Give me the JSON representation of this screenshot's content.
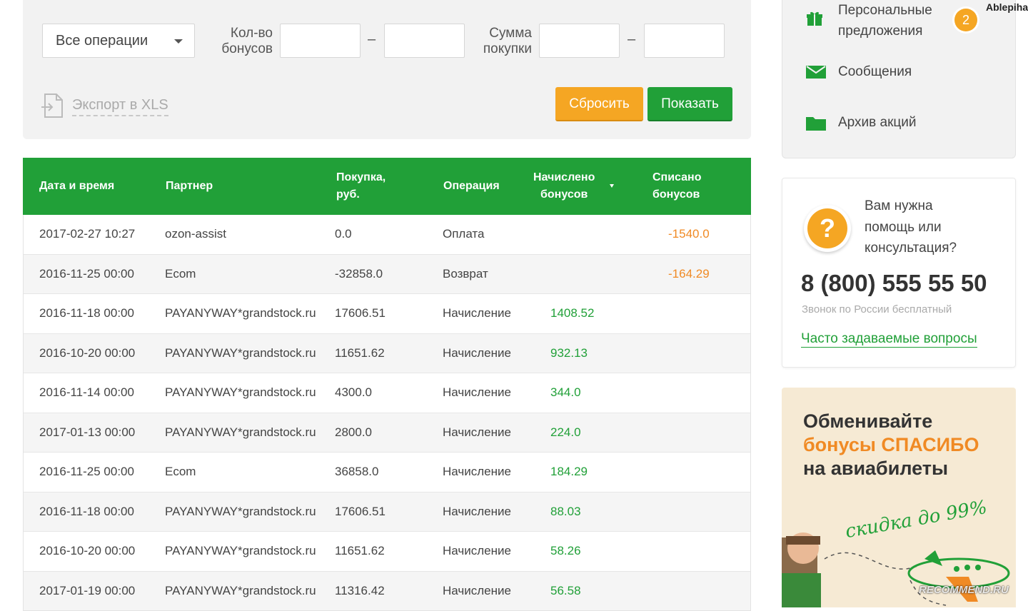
{
  "filters": {
    "operation_select": "Все операции",
    "bonus_count_label_1": "Кол-во",
    "bonus_count_label_2": "бонусов",
    "purchase_sum_label_1": "Сумма",
    "purchase_sum_label_2": "покупки",
    "range_dash": "–",
    "export_label": "Экспорт в XLS",
    "reset_label": "Сбросить",
    "show_label": "Показать"
  },
  "table": {
    "headers": {
      "date": "Дата и время",
      "partner": "Партнер",
      "amount_1": "Покупка,",
      "amount_2": "руб.",
      "operation": "Операция",
      "earned_1": "Начислено",
      "earned_2": "бонусов",
      "spent_1": "Списано",
      "spent_2": "бонусов"
    },
    "rows": [
      {
        "date": "2017-02-27 10:27",
        "partner": "ozon-assist",
        "amount": "0.0",
        "operation": "Оплата",
        "earned": "",
        "spent": "-1540.0"
      },
      {
        "date": "2016-11-25 00:00",
        "partner": "Ecom",
        "amount": "-32858.0",
        "operation": "Возврат",
        "earned": "",
        "spent": "-164.29"
      },
      {
        "date": "2016-11-18 00:00",
        "partner": "PAYANYWAY*grandstock.ru",
        "amount": "17606.51",
        "operation": "Начисление",
        "earned": "1408.52",
        "spent": ""
      },
      {
        "date": "2016-10-20 00:00",
        "partner": "PAYANYWAY*grandstock.ru",
        "amount": "11651.62",
        "operation": "Начисление",
        "earned": "932.13",
        "spent": ""
      },
      {
        "date": "2016-11-14 00:00",
        "partner": "PAYANYWAY*grandstock.ru",
        "amount": "4300.0",
        "operation": "Начисление",
        "earned": "344.0",
        "spent": ""
      },
      {
        "date": "2017-01-13 00:00",
        "partner": "PAYANYWAY*grandstock.ru",
        "amount": "2800.0",
        "operation": "Начисление",
        "earned": "224.0",
        "spent": ""
      },
      {
        "date": "2016-11-25 00:00",
        "partner": "Ecom",
        "amount": "36858.0",
        "operation": "Начисление",
        "earned": "184.29",
        "spent": ""
      },
      {
        "date": "2016-11-18 00:00",
        "partner": "PAYANYWAY*grandstock.ru",
        "amount": "17606.51",
        "operation": "Начисление",
        "earned": "88.03",
        "spent": ""
      },
      {
        "date": "2016-10-20 00:00",
        "partner": "PAYANYWAY*grandstock.ru",
        "amount": "11651.62",
        "operation": "Начисление",
        "earned": "58.26",
        "spent": ""
      },
      {
        "date": "2017-01-19 00:00",
        "partner": "PAYANYWAY*grandstock.ru",
        "amount": "11316.42",
        "operation": "Начисление",
        "earned": "56.58",
        "spent": ""
      }
    ]
  },
  "sidebar": {
    "offers_1": "Персональные",
    "offers_2": "предложения",
    "offers_badge": "2",
    "messages": "Сообщения",
    "archive": "Архив акций",
    "watermark": "Ablepiha"
  },
  "help": {
    "icon_symbol": "?",
    "text_1": "Вам нужна",
    "text_2": "помощь или",
    "text_3": "консультация?",
    "phone": "8 (800) 555 55 50",
    "phone_note": "Звонок по России бесплатный",
    "faq": "Часто задаваемые вопросы"
  },
  "promo": {
    "line_1": "Обменивайте",
    "line_2": "бонусы СПАСИБО",
    "line_3": "на авиабилеты",
    "discount": "скидка до 99%"
  },
  "recommend_watermark": "RECOMMEND.RU",
  "colors": {
    "brand_green": "#21a038",
    "accent_orange": "#f5a623",
    "spent_orange": "#f08a24"
  }
}
